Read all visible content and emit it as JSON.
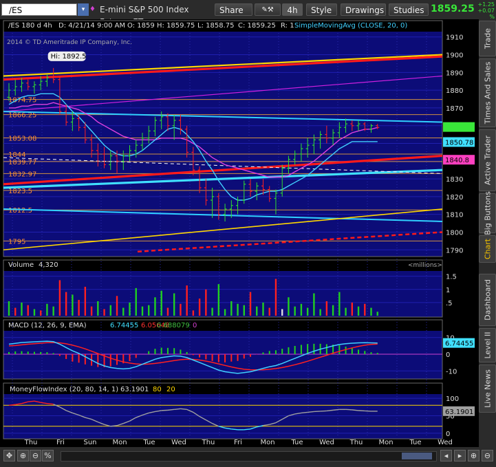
{
  "toolbar": {
    "symbol": "/ES",
    "description": "E-mini S&P 500 Index Futures,ET...",
    "share": "Share",
    "timeframe": "4h",
    "style": "Style",
    "drawings": "Drawings",
    "studies": "Studies",
    "last_price": "1859.25",
    "change_abs": "+1.25",
    "change_pct": "+0.07 %"
  },
  "sidebar": {
    "tabs": [
      "Trade",
      "Times And Sales",
      "Active Trader",
      "Big Buttons",
      "Chart",
      "Dashboard",
      "Level II",
      "Live News"
    ],
    "active": "Chart"
  },
  "chart_data": [
    {
      "type": "candlestick",
      "header": {
        "symbol_period": "/ES 180 d 4h",
        "date": "D: 4/21/14 9:00 AM",
        "open": "O: 1859",
        "high": "H: 1859.75",
        "low": "L: 1858.75",
        "close": "C: 1859.25",
        "range": "R: 1",
        "study": "SimpleMovingAvg (CLOSE, 20, 0)"
      },
      "copyright": "2014 © TD Ameritrade IP Company, Inc.",
      "hi_label": "Hi: 1892.5",
      "ylim": [
        1787,
        1913
      ],
      "ticks": [
        1790,
        1800,
        1810,
        1820,
        1830,
        1840,
        1850,
        1860,
        1870,
        1880,
        1890,
        1900,
        1910
      ],
      "price_tags": [
        {
          "value": 1850.78,
          "label": "1850.78",
          "color": "#40e0ff"
        },
        {
          "value": 1840.8,
          "label": "1840.8",
          "color": "#ff40c0"
        },
        {
          "value": 1859.25,
          "label": "",
          "color": "#39e639"
        }
      ],
      "level_labels": [
        {
          "value": 1874.75,
          "label": "1874.75"
        },
        {
          "value": 1866.25,
          "label": "1866.25"
        },
        {
          "value": 1853.08,
          "label": "1853.08"
        },
        {
          "value": 1844,
          "label": "1844"
        },
        {
          "value": 1839.77,
          "label": "1839.77"
        },
        {
          "value": 1832.97,
          "label": "1832.97"
        },
        {
          "value": 1823.5,
          "label": "1823.5"
        },
        {
          "value": 1812.5,
          "label": "1812.5"
        },
        {
          "value": 1795,
          "label": "1795"
        }
      ],
      "x_labels": [
        "Thu",
        "Fri",
        "Sun",
        "Mon",
        "Tue",
        "Wed",
        "Thu",
        "Fri",
        "Mon",
        "Tue",
        "Wed",
        "Thu",
        "Mon",
        "Tue",
        "Wed"
      ],
      "ohlc": [
        [
          1876,
          1884,
          1874,
          1880
        ],
        [
          1880,
          1886,
          1877,
          1882
        ],
        [
          1882,
          1887,
          1879,
          1884
        ],
        [
          1884,
          1886,
          1880,
          1882
        ],
        [
          1882,
          1885,
          1878,
          1883
        ],
        [
          1883,
          1888,
          1880,
          1885
        ],
        [
          1885,
          1889,
          1882,
          1887
        ],
        [
          1887,
          1892.5,
          1884,
          1886
        ],
        [
          1886,
          1888,
          1866,
          1868
        ],
        [
          1868,
          1872,
          1860,
          1862
        ],
        [
          1862,
          1868,
          1857,
          1864
        ],
        [
          1864,
          1866,
          1857,
          1859
        ],
        [
          1859,
          1862,
          1850,
          1852
        ],
        [
          1852,
          1855,
          1842,
          1846
        ],
        [
          1846,
          1850,
          1837,
          1844
        ],
        [
          1844,
          1848,
          1836,
          1838
        ],
        [
          1838,
          1846,
          1835,
          1843
        ],
        [
          1843,
          1846,
          1833,
          1840
        ],
        [
          1840,
          1846,
          1835,
          1843
        ],
        [
          1843,
          1849,
          1840,
          1846
        ],
        [
          1846,
          1852,
          1842,
          1849
        ],
        [
          1849,
          1856,
          1846,
          1853
        ],
        [
          1853,
          1860,
          1850,
          1857
        ],
        [
          1857,
          1865,
          1854,
          1863
        ],
        [
          1863,
          1868,
          1858,
          1865
        ],
        [
          1865,
          1867,
          1857,
          1860
        ],
        [
          1860,
          1866,
          1852,
          1863
        ],
        [
          1863,
          1866,
          1855,
          1858
        ],
        [
          1858,
          1860,
          1842,
          1845
        ],
        [
          1845,
          1848,
          1832,
          1835
        ],
        [
          1835,
          1837,
          1822,
          1825
        ],
        [
          1825,
          1830,
          1815,
          1818
        ],
        [
          1818,
          1825,
          1808,
          1820
        ],
        [
          1820,
          1822,
          1807,
          1810
        ],
        [
          1810,
          1816,
          1806,
          1813
        ],
        [
          1813,
          1818,
          1808,
          1815
        ],
        [
          1815,
          1820,
          1810,
          1818
        ],
        [
          1818,
          1829,
          1816,
          1827
        ],
        [
          1827,
          1830,
          1820,
          1823
        ],
        [
          1823,
          1828,
          1818,
          1826
        ],
        [
          1826,
          1830,
          1821,
          1824
        ],
        [
          1824,
          1826,
          1817,
          1819
        ],
        [
          1819,
          1824,
          1810,
          1822
        ],
        [
          1822,
          1838,
          1820,
          1836
        ],
        [
          1836,
          1843,
          1833,
          1841
        ],
        [
          1841,
          1846,
          1838,
          1844
        ],
        [
          1844,
          1850,
          1840,
          1847
        ],
        [
          1847,
          1853,
          1842,
          1849
        ],
        [
          1849,
          1855,
          1844,
          1852
        ],
        [
          1852,
          1857,
          1847,
          1855
        ],
        [
          1855,
          1860,
          1850,
          1853
        ],
        [
          1853,
          1858,
          1849,
          1856
        ],
        [
          1856,
          1862,
          1853,
          1859
        ],
        [
          1859,
          1864,
          1856,
          1861
        ],
        [
          1861,
          1863,
          1857,
          1860
        ],
        [
          1860,
          1863,
          1857,
          1861
        ],
        [
          1861,
          1862,
          1857,
          1858
        ],
        [
          1858,
          1861,
          1856,
          1860
        ],
        [
          1860,
          1861,
          1858,
          1859
        ]
      ],
      "sma_pink": [
        1870,
        1870,
        1871,
        1871,
        1872,
        1872,
        1872,
        1873,
        1872,
        1871,
        1870,
        1869,
        1867,
        1865,
        1862,
        1860,
        1858,
        1856,
        1854,
        1853,
        1852,
        1852,
        1852,
        1852,
        1853,
        1853,
        1853,
        1853,
        1852,
        1850,
        1848,
        1845,
        1842,
        1840,
        1838,
        1837,
        1836,
        1835,
        1834,
        1833,
        1832,
        1831,
        1831,
        1831,
        1832,
        1834,
        1836,
        1838,
        1840,
        1843,
        1846,
        1849,
        1852,
        1854,
        1856,
        1857,
        1858,
        1858,
        1859
      ],
      "sma_cyan": [
        1872,
        1874,
        1876,
        1877,
        1877,
        1878,
        1878,
        1878,
        1876,
        1872,
        1868,
        1865,
        1861,
        1857,
        1853,
        1849,
        1846,
        1844,
        1843,
        1843,
        1844,
        1846,
        1849,
        1852,
        1855,
        1858,
        1859,
        1858,
        1855,
        1851,
        1846,
        1840,
        1835,
        1829,
        1824,
        1820,
        1818,
        1818,
        1819,
        1821,
        1822,
        1823,
        1823,
        1824,
        1826,
        1828,
        1830,
        1832,
        1835,
        1838,
        1841,
        1844,
        1847,
        1849,
        1851,
        1851,
        1851,
        1851,
        1851
      ],
      "trendlines": [
        {
          "v0": 1888,
          "v1": 1900,
          "color": "#ffd700",
          "width": 2.2
        },
        {
          "v0": 1886,
          "v1": 1899,
          "color": "#ff1a1a",
          "width": 3.2
        },
        {
          "v0": 1868,
          "v1": 1888,
          "color": "#d020e0",
          "width": 1.2
        },
        {
          "v0": 1868,
          "v1": 1862,
          "color": "#30d0ff",
          "width": 2
        },
        {
          "v0": 1825,
          "v1": 1835,
          "color": "#40e0ff",
          "width": 3.2
        },
        {
          "v0": 1827,
          "v1": 1843,
          "color": "#ff1a1a",
          "width": 3.2
        },
        {
          "v0": 1813,
          "v1": 1806,
          "color": "#30d0ff",
          "width": 2
        },
        {
          "v0": 1790,
          "v1": 1813,
          "color": "#ffd700",
          "width": 1.6
        }
      ]
    },
    {
      "type": "bar",
      "title": "Volume",
      "value_label": "4,320",
      "units": "<millions>",
      "ylim": [
        0,
        1.7
      ],
      "ticks": [
        0.5,
        1,
        1.5
      ],
      "tick_labels": [
        ".5",
        "1",
        "1.5"
      ],
      "values": [
        0.55,
        0.3,
        0.5,
        0.4,
        0.25,
        0.2,
        0.45,
        0.35,
        1.35,
        0.9,
        0.8,
        0.6,
        1.1,
        0.35,
        0.55,
        0.25,
        0.4,
        0.75,
        0.3,
        0.5,
        1.05,
        0.35,
        0.4,
        0.7,
        0.95,
        0.3,
        0.85,
        0.45,
        1.15,
        0.2,
        0.65,
        1.0,
        0.3,
        1.2,
        0.25,
        0.55,
        0.45,
        0.4,
        0.9,
        0.35,
        0.5,
        0.3,
        1.4,
        0.25,
        0.7,
        0.35,
        0.45,
        0.3,
        0.85,
        0.25,
        0.55,
        0.4,
        0.9,
        0.3,
        0.5,
        0.35,
        0.45,
        0.3,
        0.15
      ],
      "colors": [
        "g",
        "r",
        "g",
        "r",
        "g",
        "r",
        "g",
        "g",
        "r",
        "r",
        "g",
        "r",
        "r",
        "r",
        "g",
        "r",
        "g",
        "r",
        "g",
        "g",
        "g",
        "g",
        "g",
        "g",
        "g",
        "r",
        "g",
        "r",
        "r",
        "r",
        "r",
        "r",
        "g",
        "g",
        "g",
        "g",
        "g",
        "g",
        "r",
        "g",
        "g",
        "r",
        "r",
        "w",
        "g",
        "g",
        "g",
        "g",
        "g",
        "g",
        "r",
        "g",
        "g",
        "g",
        "r",
        "g",
        "r",
        "g",
        "g"
      ]
    },
    {
      "type": "bar",
      "title": "MACD (12, 26, 9, EMA)",
      "values_text": [
        "6.74455",
        "6.05648",
        "0.688079",
        "0"
      ],
      "tag": "6.74455",
      "ylim": [
        -14,
        14
      ],
      "ticks": [
        10,
        0,
        -10
      ],
      "macd": [
        6,
        6.5,
        7,
        7.2,
        7.4,
        7.6,
        7.8,
        7.5,
        6,
        4,
        2,
        0.5,
        -1.5,
        -3.5,
        -5.5,
        -7,
        -8,
        -8.5,
        -8.8,
        -8.5,
        -7.5,
        -6,
        -4.5,
        -3,
        -2,
        -1.5,
        -1,
        -1.2,
        -2,
        -3.5,
        -5,
        -6.5,
        -8,
        -9.5,
        -10.5,
        -11,
        -11.5,
        -11,
        -10.5,
        -9.5,
        -8.5,
        -7.5,
        -6.8,
        -5.5,
        -4,
        -2.5,
        -1,
        0.5,
        1.8,
        3,
        4,
        5,
        5.8,
        6.3,
        6.6,
        6.8,
        6.9,
        6.8,
        6.7
      ],
      "signal": [
        5,
        5.2,
        5.6,
        6,
        6.3,
        6.6,
        6.9,
        7,
        6.8,
        6.2,
        5.4,
        4.4,
        3.2,
        1.8,
        0.4,
        -1,
        -2.4,
        -3.6,
        -4.6,
        -5.3,
        -5.8,
        -6,
        -5.9,
        -5.5,
        -5,
        -4.4,
        -3.8,
        -3.3,
        -3,
        -3.1,
        -3.5,
        -4.1,
        -4.9,
        -5.8,
        -6.7,
        -7.6,
        -8.4,
        -9,
        -9.3,
        -9.4,
        -9.3,
        -9,
        -8.6,
        -8,
        -7.2,
        -6.3,
        -5.3,
        -4.2,
        -3,
        -1.8,
        -0.6,
        0.6,
        1.7,
        2.8,
        3.8,
        4.7,
        5.4,
        5.9,
        6.1
      ]
    },
    {
      "type": "line",
      "title": "MoneyFlowIndex (20, 80, 14, 1)",
      "values_text": [
        "63.1901",
        "80",
        "20"
      ],
      "tag": "63.1901",
      "ylim": [
        -10,
        112
      ],
      "ticks": [
        100,
        50,
        0
      ],
      "levels": [
        80,
        20
      ],
      "values": [
        80,
        82,
        85,
        90,
        92,
        88,
        85,
        83,
        75,
        65,
        58,
        52,
        45,
        40,
        32,
        25,
        20,
        22,
        28,
        35,
        45,
        52,
        58,
        62,
        65,
        66,
        68,
        70,
        68,
        60,
        48,
        38,
        28,
        20,
        15,
        12,
        10,
        10,
        12,
        18,
        22,
        25,
        30,
        40,
        50,
        55,
        58,
        60,
        62,
        63,
        64,
        66,
        68,
        68,
        67,
        65,
        64,
        63,
        63
      ]
    }
  ]
}
